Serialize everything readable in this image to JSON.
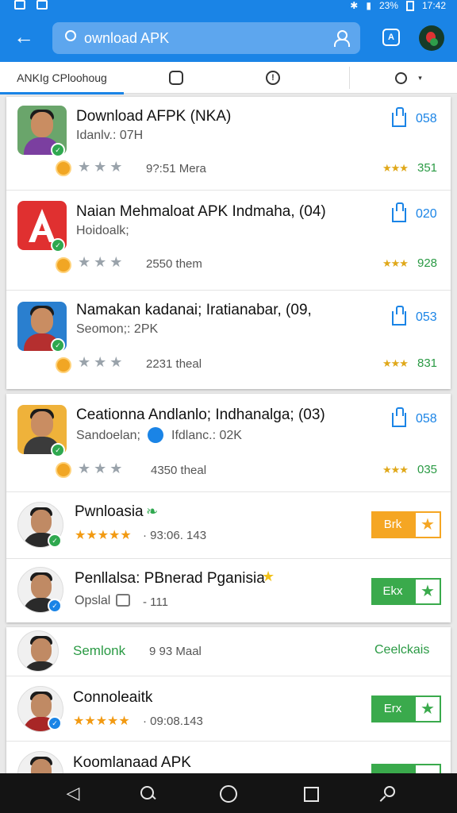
{
  "status_bar": {
    "battery": "23%",
    "time": "17:42"
  },
  "search": {
    "value": "ownload APK"
  },
  "tabs": [
    {
      "label": "ANKIg C"
    },
    {
      "label": "Ploohoug"
    }
  ],
  "apps": [
    {
      "title": "Download AFPK (NKA)",
      "sub": "Idanlv.: 07H",
      "meta": "9?:51 Mera",
      "shares": "058",
      "rating": "351"
    },
    {
      "title": "Naian Mehmaloat APK Indmaha, (04)",
      "sub": "Hoidoalk;",
      "meta": "2550 them",
      "shares": "020",
      "rating": "928"
    },
    {
      "title": "Namakan kadanai; Iratianabar, (09,",
      "sub": "Seomon;: 2PK",
      "meta": "2231 theal",
      "shares": "053",
      "rating": "831"
    },
    {
      "title": "Ceationna Andlanlo; Indhanalga; (03)",
      "sub": "Sandoelan;",
      "sub2": "Ifdlanc.: 02K",
      "meta": "4350 theal",
      "shares": "058",
      "rating": "035"
    }
  ],
  "featured": [
    {
      "title": "Pwnloasia",
      "meta": "· 93:06. 143",
      "button": "Brk"
    },
    {
      "title": "Penllalsa: PBnerad Pganisia",
      "sub": "Opslal",
      "meta": "- 111",
      "button": "Ekx"
    }
  ],
  "bottom_items": [
    {
      "title": "Semlonk",
      "meta": "9 93 Maal",
      "action": "Ceelckais"
    },
    {
      "title": "Connoleaitk",
      "meta": "· 09:08.143",
      "button": "Erx"
    },
    {
      "title": "Koomlanaad APK"
    }
  ]
}
